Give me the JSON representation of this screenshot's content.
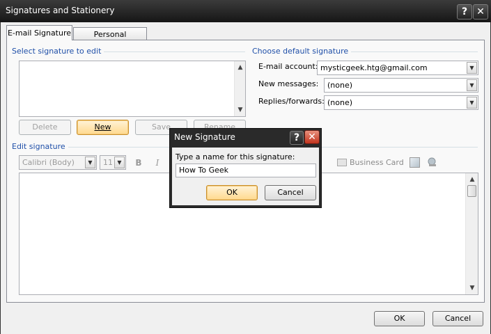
{
  "window": {
    "title": "Signatures and Stationery"
  },
  "tabs": [
    {
      "label": "E-mail Signature",
      "active": true
    },
    {
      "label": "Personal Stationery",
      "active": false
    }
  ],
  "select_group": {
    "label": "Select signature to edit"
  },
  "sig_buttons": {
    "delete": "Delete",
    "new": "New",
    "save": "Save",
    "rename": "Rename"
  },
  "default_group": {
    "label": "Choose default signature",
    "email_account_label": "E-mail account:",
    "email_account_value": "mysticgeek.htg@gmail.com",
    "new_messages_label": "New messages:",
    "new_messages_value": "(none)",
    "replies_label": "Replies/forwards:",
    "replies_value": "(none)"
  },
  "edit_group": {
    "label": "Edit signature",
    "font": "Calibri (Body)",
    "size": "11",
    "bold": "B",
    "italic": "I",
    "business_card": "Business Card"
  },
  "footer": {
    "ok": "OK",
    "cancel": "Cancel"
  },
  "dialog": {
    "title": "New Signature",
    "prompt": "Type a name for this signature:",
    "value": "How To Geek",
    "ok": "OK",
    "cancel": "Cancel"
  }
}
